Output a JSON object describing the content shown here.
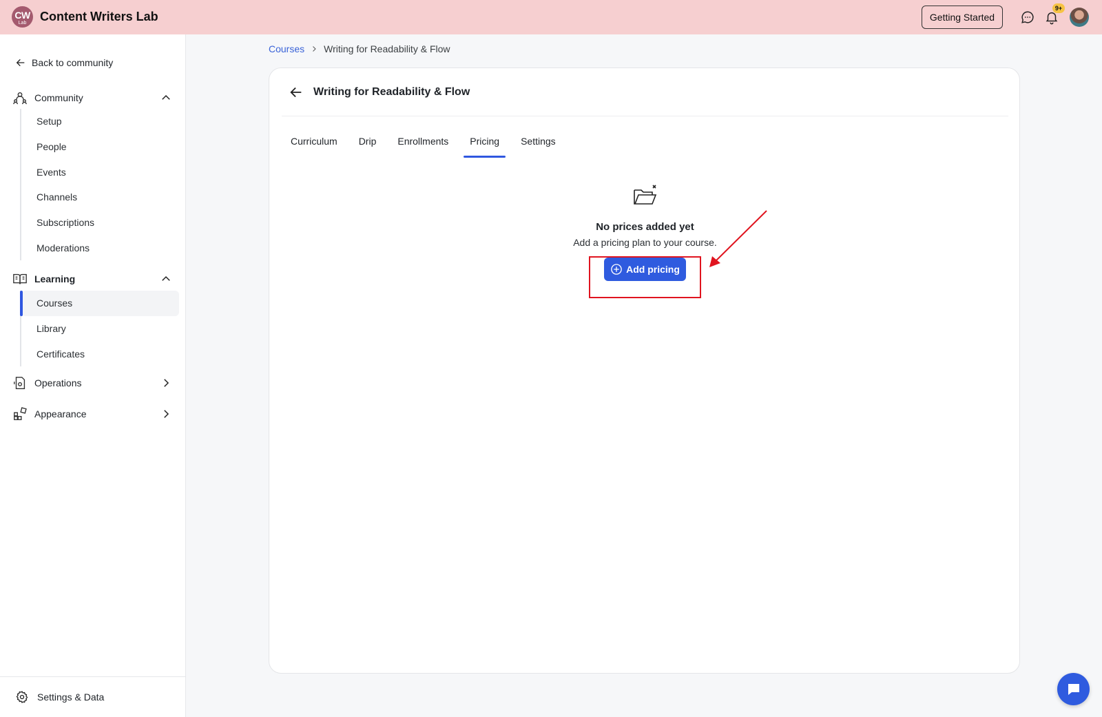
{
  "app": {
    "logo_text": "CW",
    "logo_sub": "Lab",
    "title": "Content Writers Lab",
    "getting_started_label": "Getting Started",
    "notification_badge": "9+"
  },
  "sidebar": {
    "back_label": "Back to community",
    "groups": [
      {
        "label": "Community",
        "expanded": true,
        "items": [
          "Setup",
          "People",
          "Events",
          "Channels",
          "Subscriptions",
          "Moderations"
        ]
      },
      {
        "label": "Learning",
        "expanded": true,
        "items": [
          "Courses",
          "Library",
          "Certificates"
        ],
        "active_item": "Courses"
      },
      {
        "label": "Operations",
        "expanded": false
      },
      {
        "label": "Appearance",
        "expanded": false
      }
    ],
    "footer_label": "Settings & Data"
  },
  "breadcrumb": {
    "parent": "Courses",
    "current": "Writing for Readability & Flow"
  },
  "course": {
    "title": "Writing for Readability & Flow",
    "tabs": [
      "Curriculum",
      "Drip",
      "Enrollments",
      "Pricing",
      "Settings"
    ],
    "active_tab": "Pricing"
  },
  "empty_state": {
    "title": "No prices added yet",
    "subtitle": "Add a pricing plan to your course.",
    "button_label": "Add pricing"
  },
  "colors": {
    "topbar": "#f6cfd0",
    "accent": "#2f5bdf",
    "annotation": "#e0141f"
  }
}
